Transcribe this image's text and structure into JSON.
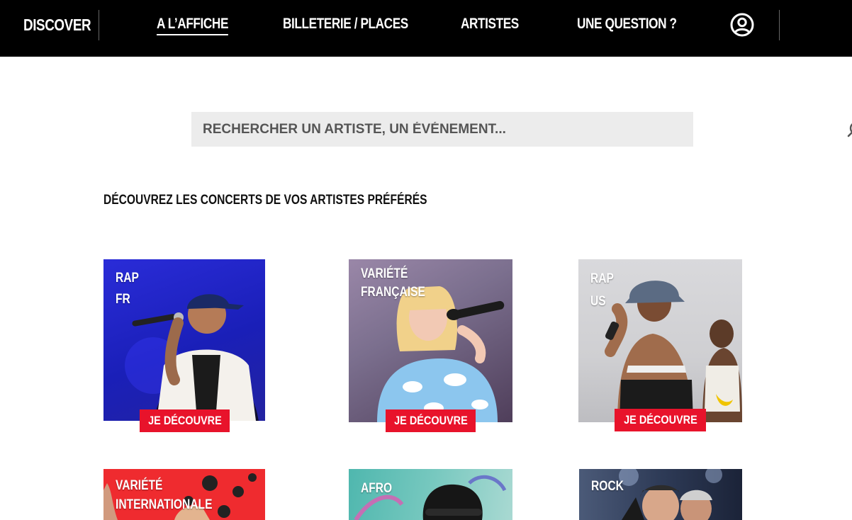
{
  "nav": {
    "brand": "DISCOVER",
    "items": [
      "A L’AFFICHE",
      "BILLETERIE / PLACES",
      "ARTISTES",
      "UNE QUESTION ?"
    ],
    "user_icon": "user-circle-icon"
  },
  "search": {
    "placeholder": "RECHERCHER UN ARTISTE, UN ÉVÉNEMENT...",
    "icon": "search-icon"
  },
  "section_title": "DÉCOUVREZ LES CONCERTS DE VOS ARTISTES PRÉFÉRÉS",
  "cards": [
    {
      "label": "RAP\nFR",
      "cta": "JE DÉCOUVRE"
    },
    {
      "label": "VARIÉTÉ\nFRANÇAISE",
      "cta": "JE DÉCOUVRE"
    },
    {
      "label": "RAP\nUS",
      "cta": "JE DÉCOUVRE"
    },
    {
      "label": "VARIÉTÉ\nINTERNATIONALE"
    },
    {
      "label": "AFRO"
    },
    {
      "label": "ROCK"
    }
  ],
  "colors": {
    "nav_bg": "#000000",
    "accent": "#e8132b",
    "search_bg": "#ececec"
  }
}
